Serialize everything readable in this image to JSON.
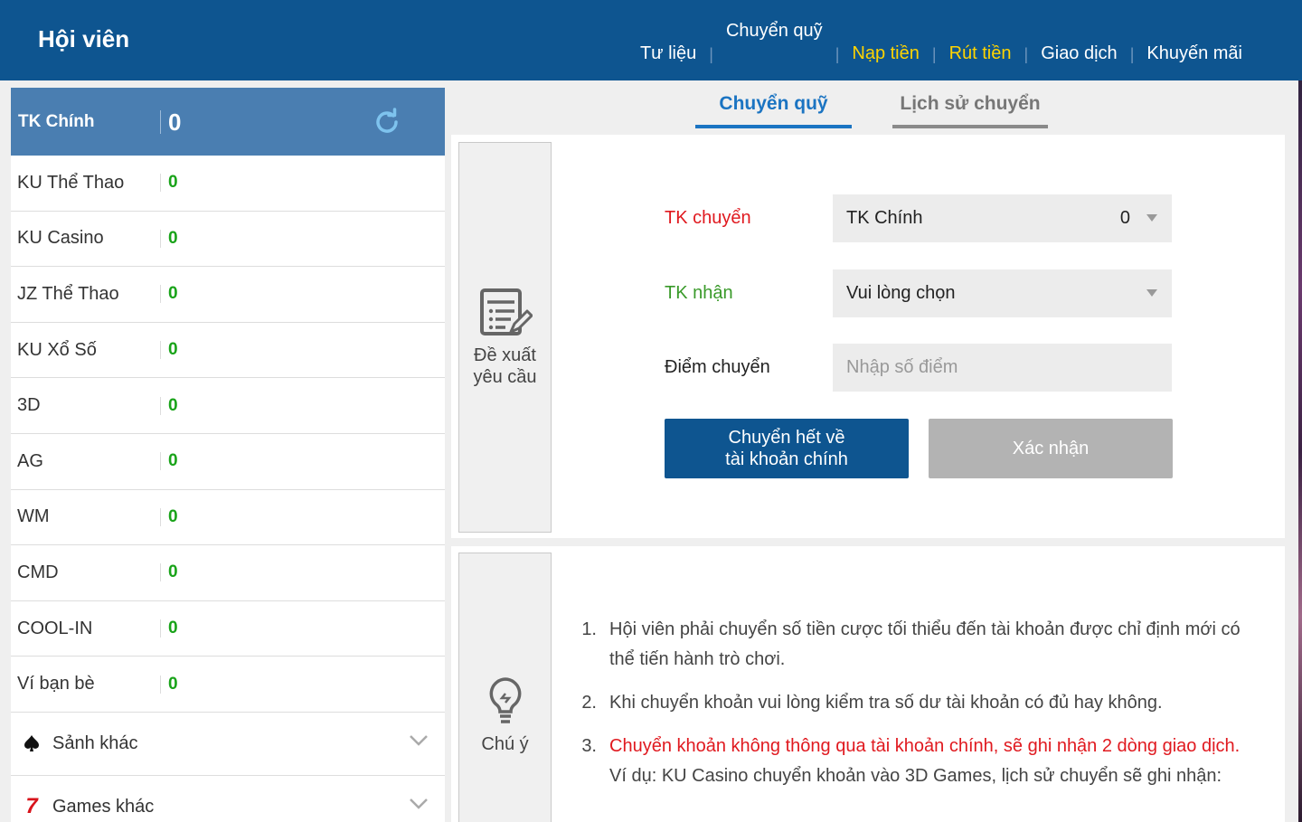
{
  "header": {
    "title": "Hội viên",
    "nav": [
      {
        "label": "Tư liệu",
        "style": "white"
      },
      {
        "label": "Chuyển quỹ",
        "style": "active"
      },
      {
        "label": "Nạp tiền",
        "style": "yellow"
      },
      {
        "label": "Rút tiền",
        "style": "yellow"
      },
      {
        "label": "Giao dịch",
        "style": "white"
      },
      {
        "label": "Khuyến mãi",
        "style": "white"
      }
    ]
  },
  "sidebar": {
    "main_label": "TK Chính",
    "main_value": "0",
    "accounts": [
      {
        "label": "KU Thể Thao",
        "value": "0"
      },
      {
        "label": "KU Casino",
        "value": "0"
      },
      {
        "label": "JZ Thể Thao",
        "value": "0"
      },
      {
        "label": "KU Xổ Số",
        "value": "0"
      },
      {
        "label": "3D",
        "value": "0"
      },
      {
        "label": "AG",
        "value": "0"
      },
      {
        "label": "WM",
        "value": "0"
      },
      {
        "label": "CMD",
        "value": "0"
      },
      {
        "label": "COOL-IN",
        "value": "0"
      },
      {
        "label": "Ví bạn bè",
        "value": "0"
      }
    ],
    "groups": [
      {
        "label": "Sảnh khác",
        "icon": "spade-icon"
      },
      {
        "label": "Games khác",
        "icon": "seven-icon"
      }
    ]
  },
  "tabs": {
    "active": "Chuyển quỹ",
    "inactive": "Lịch sử chuyển"
  },
  "form": {
    "side_label_line1": "Đề xuất",
    "side_label_line2": "yêu cầu",
    "from_label": "TK chuyển",
    "from_value": "TK Chính",
    "from_amount": "0",
    "to_label": "TK nhận",
    "to_value": "Vui lòng chọn",
    "points_label": "Điểm chuyển",
    "points_placeholder": "Nhập số điểm",
    "btn_transfer_all_line1": "Chuyển hết về",
    "btn_transfer_all_line2": "tài khoản chính",
    "btn_confirm": "Xác nhận"
  },
  "notes": {
    "side_label": "Chú ý",
    "items": [
      {
        "num": "1.",
        "text": "Hội viên phải chuyển số tiền cược tối thiểu đến tài khoản được chỉ định mới có thể tiến hành trò chơi."
      },
      {
        "num": "2.",
        "text": "Khi chuyển khoản vui lòng kiểm tra số dư tài khoản có đủ hay không."
      },
      {
        "num": "3.",
        "text": "Chuyển khoản không thông qua tài khoản chính, sẽ ghi nhận 2 dòng giao dịch."
      }
    ],
    "example": "Ví dụ: KU Casino chuyển khoản vào 3D Games, lịch sử chuyển sẽ ghi nhận:"
  },
  "colors": {
    "header_bg": "#0e5590",
    "sidebar_head_bg": "#4a7eb1",
    "value_green": "#19a319",
    "active_tab": "#1b74c2",
    "nav_yellow": "#ffd400",
    "label_red": "#e0191f",
    "label_green": "#3a9a2a"
  }
}
